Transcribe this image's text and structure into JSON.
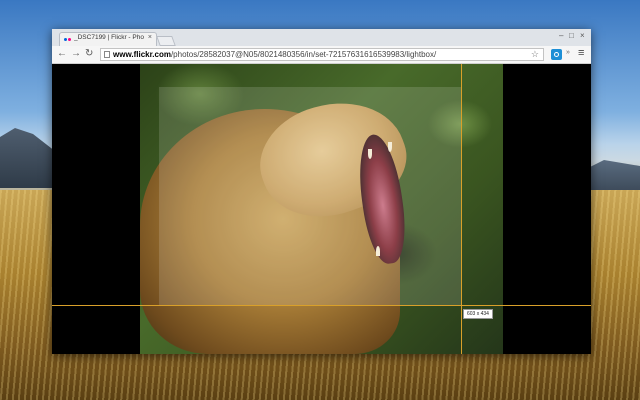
{
  "browser": {
    "tab": {
      "title": "_DSC7199 | Flickr - Pho",
      "close": "×"
    },
    "window_controls": {
      "minimize": "–",
      "maximize": "□",
      "close": "×"
    },
    "nav": {
      "back": "←",
      "forward": "→",
      "reload": "↻"
    },
    "url_domain": "www.flickr.com",
    "url_path": "/photos/28582037@N05/8021480356/in/set-72157631616539983/lightbox/",
    "star": "☆",
    "menu": "≡",
    "ext_arrow": "»"
  },
  "overlay": {
    "dimension_label": "603 x 434",
    "guide_color": "#d9a02a"
  }
}
